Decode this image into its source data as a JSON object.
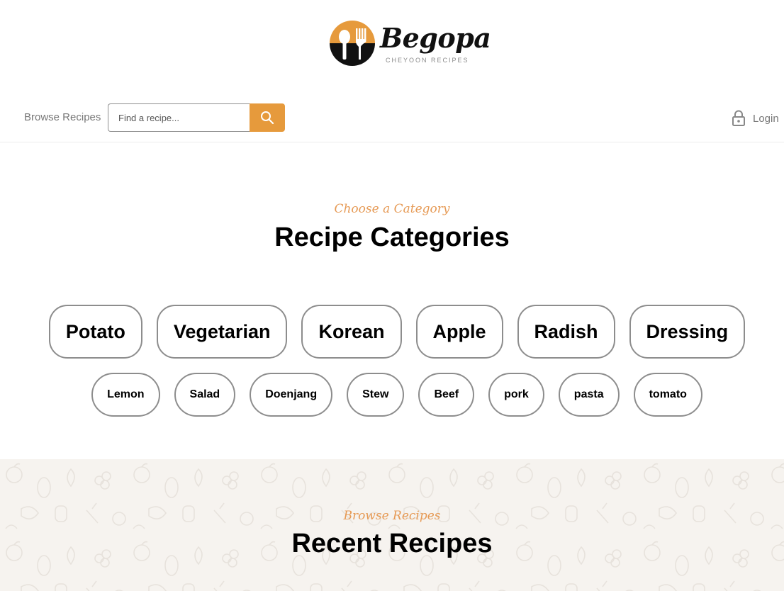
{
  "brand": {
    "name": "Begopa",
    "tagline": "CHEYOON RECIPES",
    "colors": {
      "accent": "#e69a3c",
      "accent_text": "#e69a55",
      "dark": "#111111"
    }
  },
  "nav": {
    "browse_label": "Browse Recipes",
    "search": {
      "placeholder": "Find a recipe...",
      "value": "",
      "button_icon": "search-icon"
    },
    "login_label": "Login",
    "login_icon": "lock-icon"
  },
  "categories": {
    "eyebrow": "Choose a Category",
    "title": "Recipe Categories",
    "primary": [
      "Potato",
      "Vegetarian",
      "Korean",
      "Apple",
      "Radish",
      "Dressing"
    ],
    "secondary": [
      "Lemon",
      "Salad",
      "Doenjang",
      "Stew",
      "Beef",
      "pork",
      "pasta",
      "tomato"
    ]
  },
  "recent": {
    "eyebrow": "Browse Recipes",
    "title": "Recent Recipes"
  }
}
